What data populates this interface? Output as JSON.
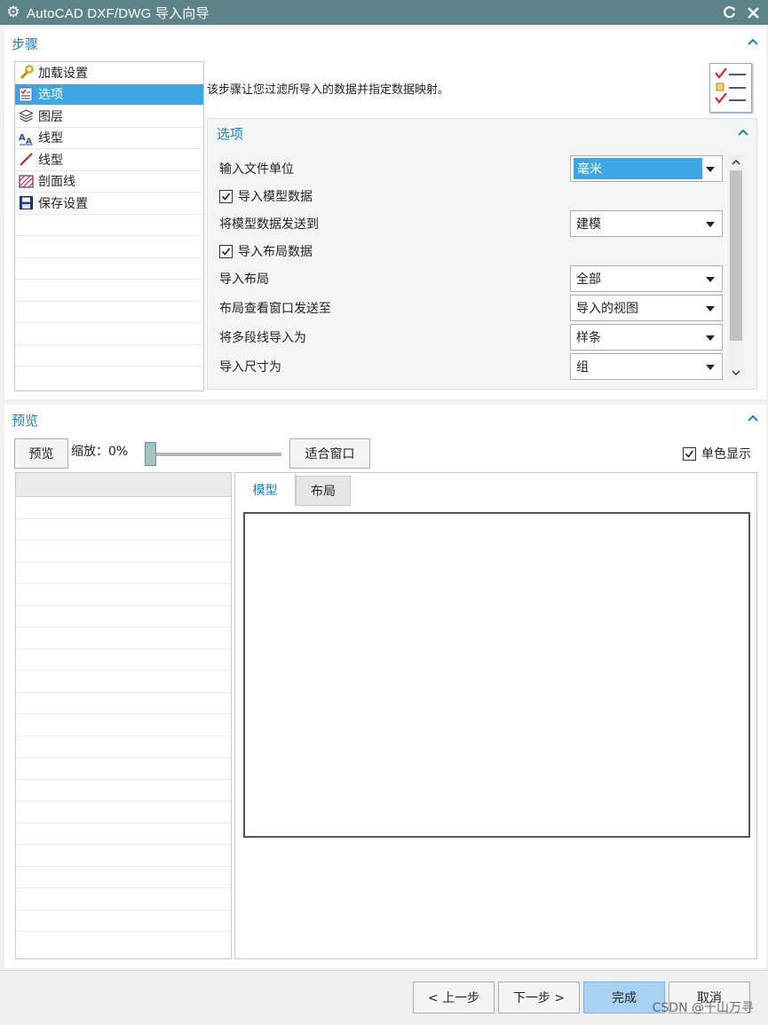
{
  "window": {
    "title": "AutoCAD DXF/DWG 导入向导"
  },
  "steps_group": {
    "title": "步骤",
    "items": [
      {
        "label": "加载设置",
        "icon": "wrench-icon"
      },
      {
        "label": "选项",
        "icon": "checklist-icon",
        "selected": true
      },
      {
        "label": "图层",
        "icon": "layers-icon"
      },
      {
        "label": "线型",
        "icon": "text-style-icon"
      },
      {
        "label": "线型",
        "icon": "line-icon"
      },
      {
        "label": "剖面线",
        "icon": "hatch-icon"
      },
      {
        "label": "保存设置",
        "icon": "save-icon"
      }
    ],
    "description": "该步骤让您过滤所导入的数据并指定数据映射。"
  },
  "options_group": {
    "title": "选项",
    "input_file_units_label": "输入文件单位",
    "input_file_units_value": "毫米",
    "import_model_data_label": "导入模型数据",
    "import_model_data_checked": true,
    "send_model_data_label": "将模型数据发送到",
    "send_model_data_value": "建模",
    "import_layout_data_label": "导入布局数据",
    "import_layout_data_checked": true,
    "import_layout_label": "导入布局",
    "import_layout_value": "全部",
    "layout_viewport_label": "布局查看窗口发送至",
    "layout_viewport_value": "导入的视图",
    "polyline_label": "将多段线导入为",
    "polyline_value": "样条",
    "dimension_label": "导入尺寸为",
    "dimension_value": "组"
  },
  "preview_group": {
    "title": "预览",
    "preview_button": "预览",
    "zoom_label": "缩放：0%",
    "zoom_percent": 0,
    "fit_window_button": "适合窗口",
    "monochrome_label": "单色显示",
    "monochrome_checked": true,
    "tabs": [
      {
        "label": "模型",
        "active": true
      },
      {
        "label": "布局",
        "active": false
      }
    ]
  },
  "footer": {
    "back_button": "< 上一步",
    "next_button": "下一步 >",
    "finish_button": "完成",
    "cancel_button": "取消"
  },
  "watermark": "CSDN @千山万寻",
  "colors": {
    "titlebar": "#5b8388",
    "accent": "#1f7fbf",
    "selection": "#3fa6e6",
    "primary_button": "#a9d1f1"
  }
}
